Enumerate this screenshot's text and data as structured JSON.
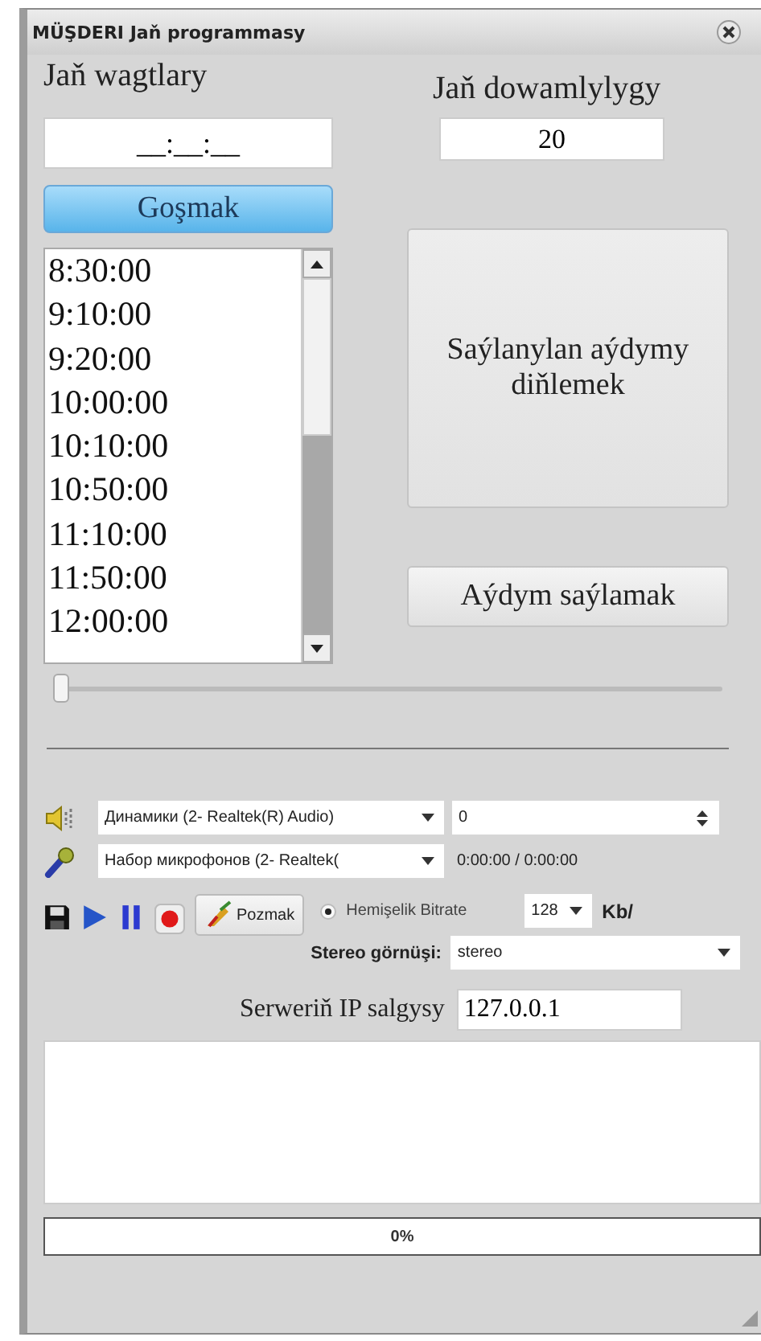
{
  "window": {
    "title": "MÜŞDERI Jaň programmasy"
  },
  "times_label": "Jaň wagtlary",
  "time_input": {
    "value": "__:__:__"
  },
  "duration_label": "Jaň dowamlylygy",
  "duration_input": {
    "value": "20"
  },
  "add_button": "Goşmak",
  "times": [
    "8:30:00",
    "9:10:00",
    "9:20:00",
    "10:00:00",
    "10:10:00",
    "10:50:00",
    "11:10:00",
    "11:50:00",
    "12:00:00"
  ],
  "listen_button": "Saýlanylan aýdymy diňlemek",
  "choose_button": "Aýdym saýlamak",
  "position_slider": {
    "level": 0
  },
  "speaker": {
    "device": "Динамики (2- Realtek(R) Audio)",
    "volume": "0"
  },
  "microphone": {
    "device": "Набор микрофонов (2- Realtek(",
    "time": "0:00:00 / 0:00:00"
  },
  "toolbar": [
    {
      "kind": "save"
    },
    {
      "kind": "play"
    },
    {
      "kind": "pause"
    },
    {
      "kind": "record"
    }
  ],
  "delete_button": "Pozmak",
  "bitrate": {
    "label": "Hemişelik Bitrate",
    "selected": true,
    "value": "128",
    "unit": "Kb/"
  },
  "stereo": {
    "label": "Stereo görnüşi:",
    "value": "stereo"
  },
  "server": {
    "label": "Serweriň IP salgysy",
    "value": "127.0.0.1"
  },
  "progress": {
    "level": 0,
    "text": "0%"
  }
}
